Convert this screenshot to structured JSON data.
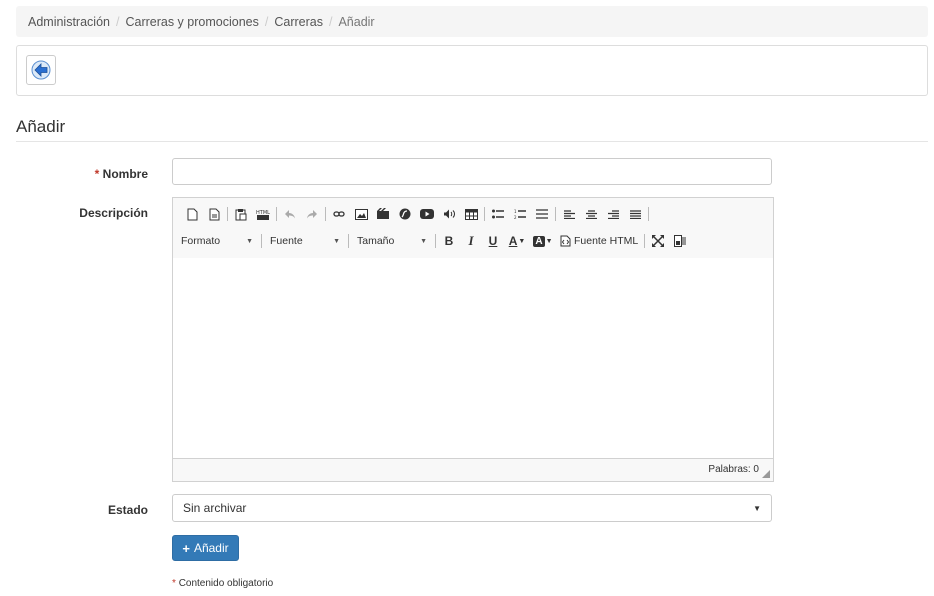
{
  "breadcrumb": {
    "items": [
      "Administración",
      "Carreras y promociones",
      "Carreras",
      "Añadir"
    ],
    "separator": "/"
  },
  "toolbar": {
    "back_icon": "back-arrow-icon"
  },
  "page": {
    "title": "Añadir"
  },
  "form": {
    "nombre_required_mark": "*",
    "nombre_label": "Nombre",
    "nombre_value": "",
    "descripcion_label": "Descripción",
    "estado_label": "Estado",
    "estado_value": "Sin archivar",
    "submit_label": "Añadir",
    "submit_icon": "plus-icon",
    "required_note_mark": "*",
    "required_note": "Contenido obligatorio"
  },
  "editor": {
    "format_label": "Formato",
    "font_label": "Fuente",
    "size_label": "Tamaño",
    "bold_label": "B",
    "italic_label": "I",
    "underline_label": "U",
    "text_color_label": "A",
    "bg_color_label": "A",
    "source_label": "Fuente HTML",
    "word_count": "Palabras: 0"
  },
  "colors": {
    "accent": "#337ab7",
    "required": "#c0392b"
  }
}
